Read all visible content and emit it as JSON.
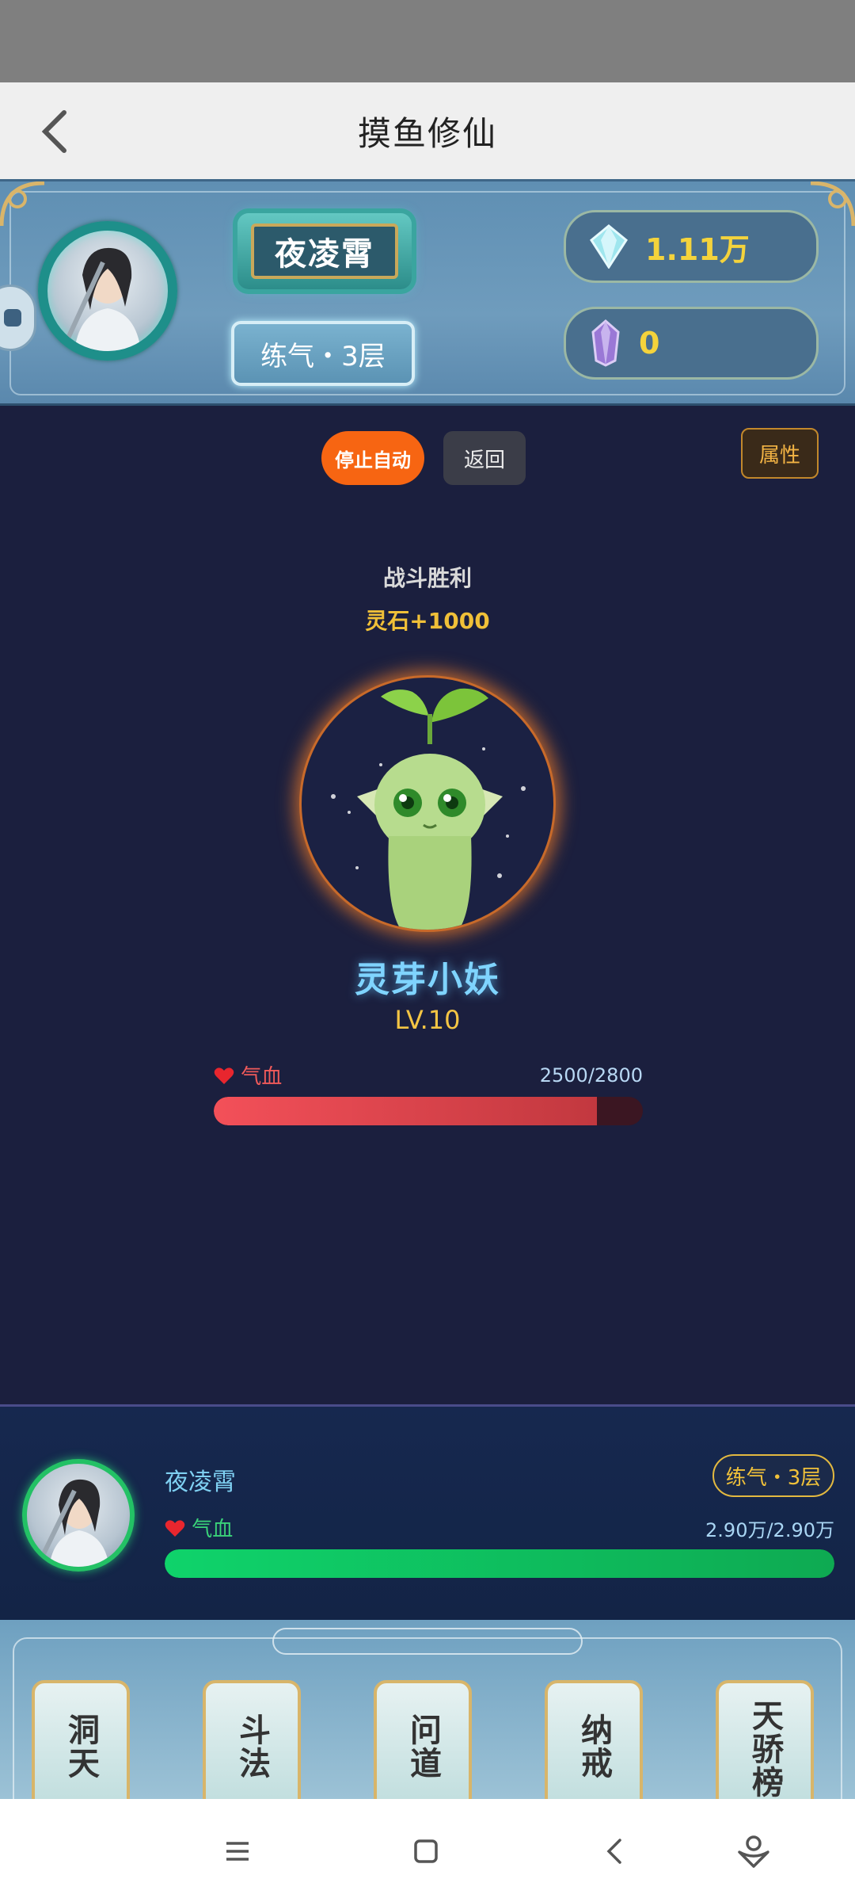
{
  "header": {
    "title": "摸鱼修仙"
  },
  "player": {
    "name": "夜凌霄",
    "realm": "练气・3层",
    "spirit_stones": "1.11万",
    "crystals": "0",
    "hp_label": "气血",
    "hp_text": "2.90万/2.90万",
    "hp_fraction": 1.0
  },
  "controls": {
    "stop_auto": "停止自动",
    "back": "返回",
    "attributes": "属性"
  },
  "battle": {
    "result": "战斗胜利",
    "reward": "灵石+1000"
  },
  "monster": {
    "name": "灵芽小妖",
    "level": "LV.10",
    "hp_label": "气血",
    "hp_text": "2500/2800",
    "hp_fraction": 0.893
  },
  "menu": {
    "items": [
      "洞天",
      "斗法",
      "问道",
      "纳戒",
      "天骄榜"
    ]
  },
  "colors": {
    "accent_orange": "#f76512",
    "gold": "#f4c544",
    "monster_hp": "#f35059",
    "player_hp": "#0fd36b",
    "name_blue": "#7fd4ff"
  },
  "icons": {
    "back": "chevron-left-icon",
    "stone": "diamond-gem-icon",
    "crystal": "purple-crystal-icon",
    "heart": "heart-icon",
    "nav": [
      "menu-icon",
      "home-square-icon",
      "back-icon",
      "assistant-icon"
    ]
  }
}
